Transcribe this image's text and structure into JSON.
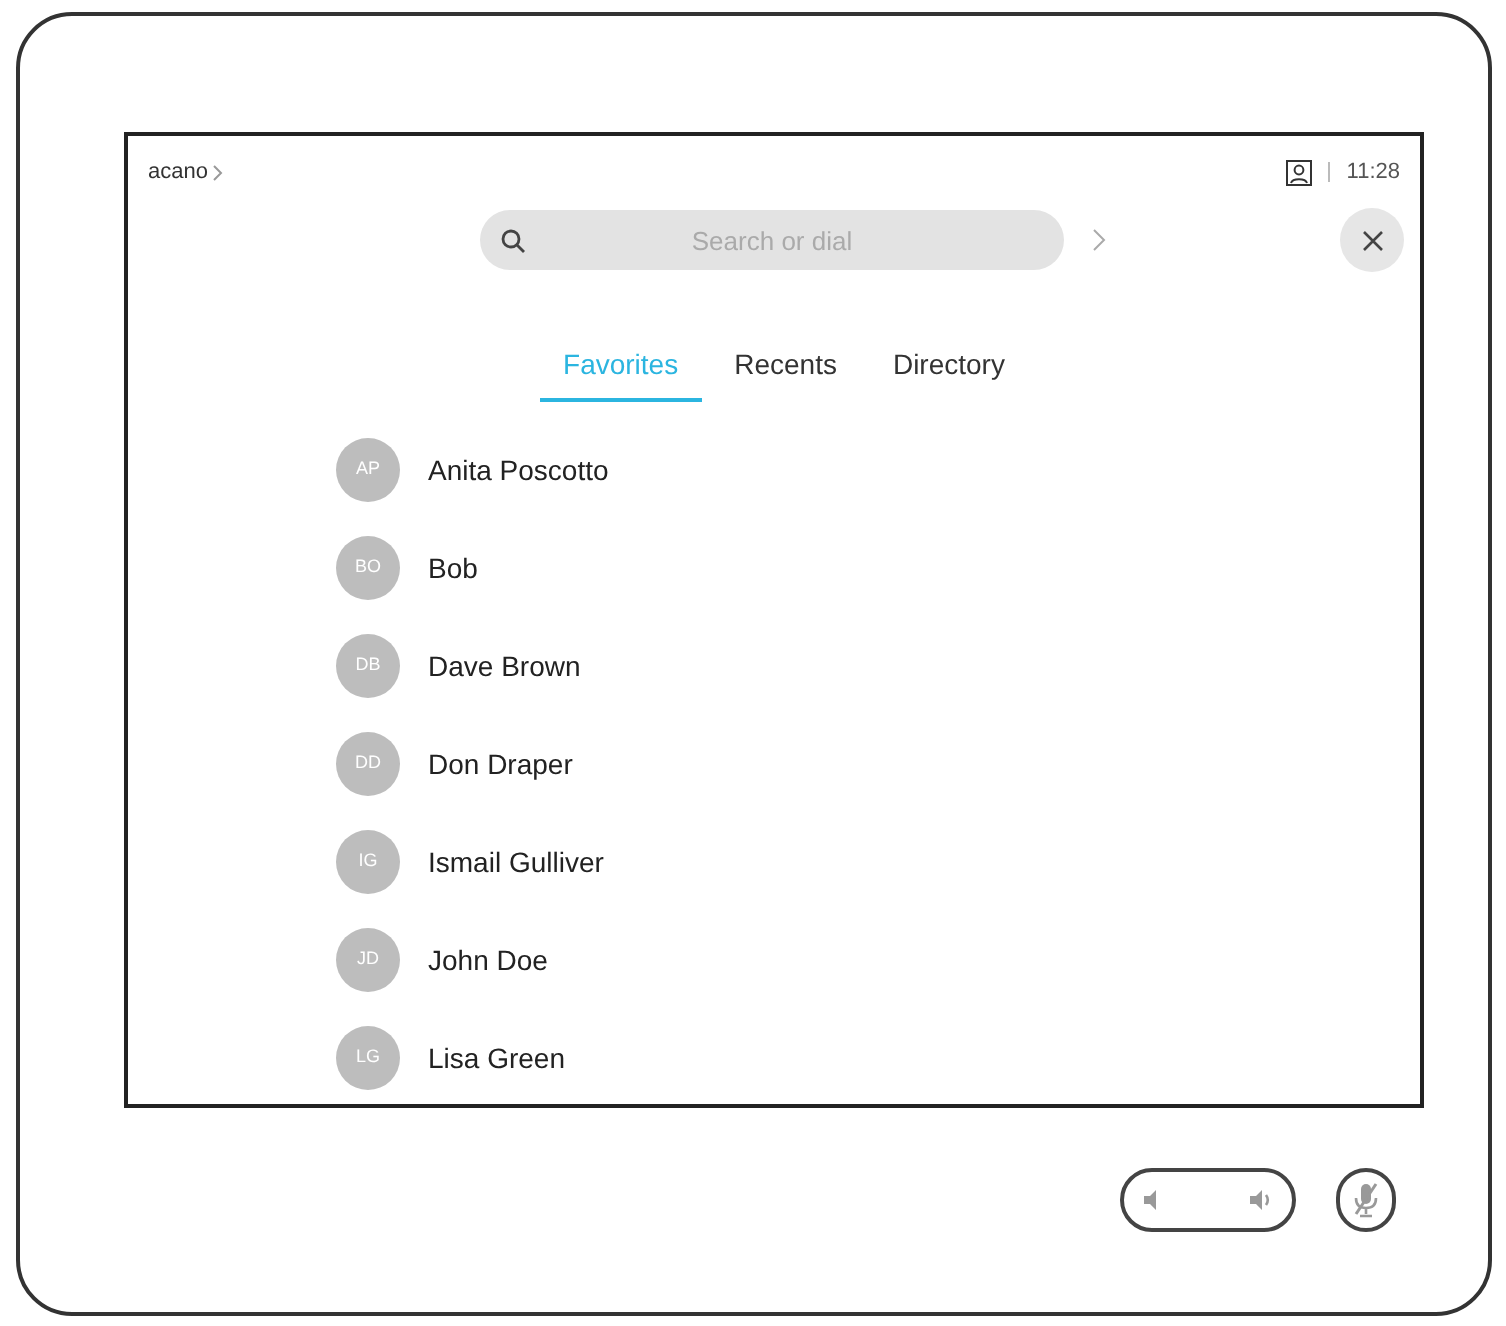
{
  "top_bar": {
    "brand": "acano",
    "time": "11:28"
  },
  "search": {
    "placeholder": "Search or dial"
  },
  "tabs": [
    {
      "label": "Favorites",
      "selected": true
    },
    {
      "label": "Recents",
      "selected": false
    },
    {
      "label": "Directory",
      "selected": false
    }
  ],
  "contacts": [
    {
      "initials": "AP",
      "name": "Anita Poscotto"
    },
    {
      "initials": "BO",
      "name": "Bob"
    },
    {
      "initials": "DB",
      "name": "Dave Brown"
    },
    {
      "initials": "DD",
      "name": "Don Draper"
    },
    {
      "initials": "IG",
      "name": "Ismail Gulliver"
    },
    {
      "initials": "JD",
      "name": "John Doe"
    },
    {
      "initials": "LG",
      "name": "Lisa Green"
    }
  ]
}
